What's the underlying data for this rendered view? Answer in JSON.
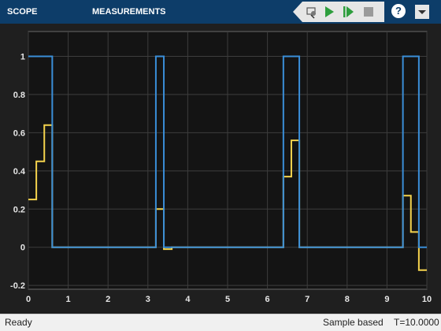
{
  "toolbar": {
    "tabs": [
      {
        "label": "SCOPE"
      },
      {
        "label": "MEASUREMENTS"
      }
    ],
    "icons": [
      "highlight-simulink-block-icon",
      "run-icon",
      "step-forward-icon",
      "stop-icon",
      "help-icon",
      "menu-icon"
    ],
    "help_label": "?"
  },
  "status": {
    "state": "Ready",
    "mode": "Sample based",
    "time": "T=10.0000"
  },
  "colors": {
    "plot_bg": "#141414",
    "grid": "#3d3d3d",
    "axis_text": "#e6e6e6",
    "series_blue": "#3a8ed8",
    "series_yellow": "#f5d34d"
  },
  "chart_data": {
    "type": "line",
    "title": "",
    "xlabel": "",
    "ylabel": "",
    "xlim": [
      0,
      10
    ],
    "ylim": [
      -0.22,
      1.13
    ],
    "xticks": [
      "0",
      "1",
      "2",
      "3",
      "4",
      "5",
      "6",
      "7",
      "8",
      "9",
      "10"
    ],
    "xtick_values": [
      0,
      1,
      2,
      3,
      4,
      5,
      6,
      7,
      8,
      9,
      10
    ],
    "yticks": [
      "-0.2",
      "0",
      "0.2",
      "0.4",
      "0.6",
      "0.8",
      "1"
    ],
    "ytick_values": [
      -0.2,
      0,
      0.2,
      0.4,
      0.6,
      0.8,
      1
    ],
    "grid": true,
    "series": [
      {
        "color": "#3a8ed8",
        "step": true,
        "x": [
          0,
          0.6,
          3.2,
          3.4,
          6.4,
          6.8,
          9.4,
          9.8,
          10
        ],
        "y": [
          1,
          0,
          1,
          0,
          1,
          0,
          1,
          0,
          0
        ]
      },
      {
        "color": "#f5d34d",
        "step": true,
        "x": [
          0,
          0.2,
          0.4,
          0.6,
          3.2,
          3.4,
          3.6,
          6.4,
          6.6,
          6.8,
          9.4,
          9.6,
          9.8,
          10
        ],
        "y": [
          0.25,
          0.45,
          0.64,
          0,
          0.2,
          -0.01,
          0,
          0.37,
          0.56,
          0,
          0.27,
          0.08,
          -0.12,
          -0.12
        ]
      }
    ]
  }
}
